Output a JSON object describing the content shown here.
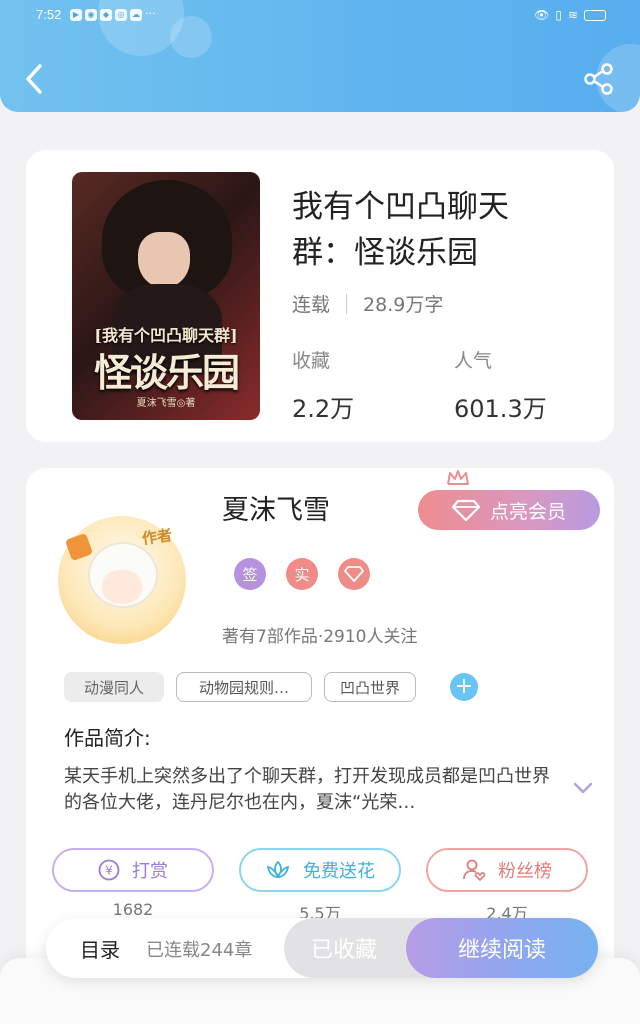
{
  "status_bar": {
    "time": "7:52",
    "more": "···"
  },
  "book": {
    "title": "我有个凹凸聊天群：怪谈乐园",
    "status": "连载",
    "word_count": "28.9万字",
    "collect_label": "收藏",
    "collect_value": "2.2万",
    "popularity_label": "人气",
    "popularity_value": "601.3万",
    "cover": {
      "subtitle": "[我有个凹凸聊天群]",
      "title": "怪谈乐园",
      "author": "夏沫飞雪◎著"
    }
  },
  "author": {
    "avatar_tag": "作者",
    "name": "夏沫飞雪",
    "vip_button": "点亮会员",
    "badges": [
      "签",
      "实"
    ],
    "works_info": "著有7部作品·2910人关注"
  },
  "tags": [
    "动漫同人",
    "动物园规则…",
    "凹凸世界"
  ],
  "intro": {
    "heading": "作品简介:",
    "text": "某天手机上突然多出了个聊天群，打开发现成员都是凹凸世界的各位大佬，连丹尼尔也在内，夏沫“光荣…"
  },
  "actions": [
    {
      "label": "打赏",
      "count": "1682"
    },
    {
      "label": "免费送花",
      "count": "5.5万"
    },
    {
      "label": "粉丝榜",
      "count": "2.4万"
    }
  ],
  "bottom_bar": {
    "toc": "目录",
    "chapters": "已连载244章",
    "collected": "已收藏",
    "continue": "继续阅读"
  },
  "colors": {
    "header": "#5fb5ee",
    "accent_purple": "#b79be0",
    "accent_cyan": "#5fc4e8",
    "accent_red": "#e27b7b"
  }
}
